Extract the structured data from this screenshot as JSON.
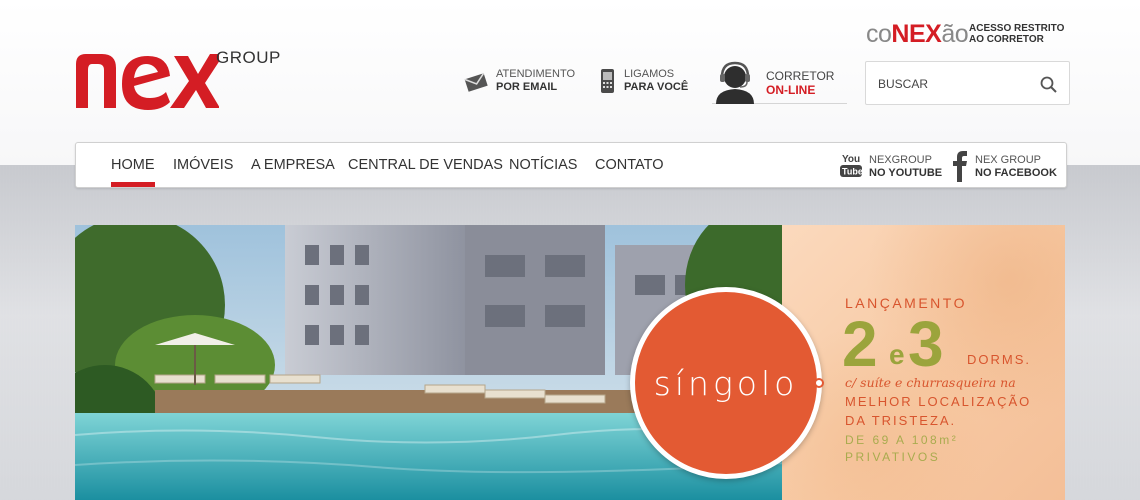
{
  "logo": {
    "brand": "nex",
    "group": "GROUP"
  },
  "conexao": {
    "co": "co",
    "nex": "NEX",
    "ao": "ão",
    "line1": "ACESSO RESTRITO",
    "line2": "AO CORRETOR"
  },
  "contacts": [
    {
      "line1": "ATENDIMENTO",
      "line2": "POR EMAIL",
      "icon": "envelope-icon"
    },
    {
      "line1": "LIGAMOS",
      "line2": "PARA VOCÊ",
      "icon": "phone-icon"
    }
  ],
  "corretor": {
    "line1": "CORRETOR",
    "line2": "ON-LINE",
    "icon": "headset-agent-icon"
  },
  "search": {
    "placeholder": "BUSCAR",
    "icon": "search-icon"
  },
  "nav": {
    "items": [
      "HOME",
      "IMÓVEIS",
      "A EMPRESA",
      "CENTRAL DE VENDAS",
      "NOTÍCIAS",
      "CONTATO"
    ],
    "active": "HOME"
  },
  "social": [
    {
      "line1": "NEXGROUP",
      "line2": "NO YOUTUBE",
      "icon": "youtube-icon"
    },
    {
      "line1": "NEX GROUP",
      "line2": "NO FACEBOOK",
      "icon": "facebook-icon"
    }
  ],
  "banner": {
    "brand": "síngolo",
    "launch": "LANÇAMENTO",
    "num1": "2",
    "e": "e",
    "num2": "3",
    "dorms": "DORMS.",
    "suite": "c/ suíte e churrasqueira na",
    "location1": "MELHOR LOCALIZAÇÃO",
    "location2": "DA TRISTEZA.",
    "area1": "DE 69 A 108m²",
    "area2": "PRIVATIVOS"
  },
  "colors": {
    "brand_red": "#d41d24",
    "promo_orange": "#e35a33",
    "promo_green": "#9ba43c"
  }
}
